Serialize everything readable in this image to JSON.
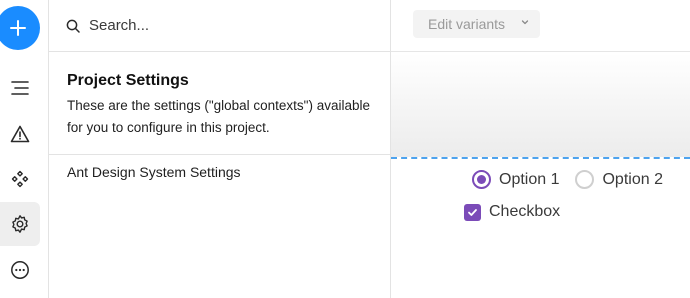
{
  "rail": {
    "items": [
      {
        "icon": "add-icon",
        "active": false
      },
      {
        "icon": "outline-icon",
        "active": false
      },
      {
        "icon": "warning-icon",
        "active": false
      },
      {
        "icon": "components-icon",
        "active": false
      },
      {
        "icon": "settings-icon",
        "active": true
      },
      {
        "icon": "more-icon",
        "active": false
      }
    ],
    "accent_color": "#1a8cff"
  },
  "search": {
    "placeholder": "Search..."
  },
  "settings": {
    "title": "Project Settings",
    "description": "These are the settings (\"global contexts\") available for you to configure in this project.",
    "items": [
      {
        "label": "Ant Design System Settings"
      }
    ]
  },
  "canvas": {
    "variants_button": "Edit variants",
    "radio_options": [
      {
        "label": "Option 1",
        "checked": true
      },
      {
        "label": "Option 2",
        "checked": false
      }
    ],
    "checkbox": {
      "label": "Checkbox",
      "checked": true
    },
    "control_color": "#7b4bb8"
  }
}
